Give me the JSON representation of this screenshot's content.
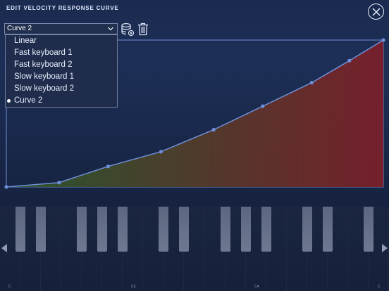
{
  "header": {
    "title": "EDIT VELOCITY RESPONSE CURVE"
  },
  "curve_selector": {
    "value": "Curve 2",
    "options": [
      {
        "label": "Linear",
        "selected": false
      },
      {
        "label": "Fast keyboard 1",
        "selected": false
      },
      {
        "label": "Fast keyboard 2",
        "selected": false
      },
      {
        "label": "Slow keyboard 1",
        "selected": false
      },
      {
        "label": "Slow keyboard 2",
        "selected": false
      },
      {
        "label": "Curve 2",
        "selected": true
      }
    ]
  },
  "icons": {
    "close": "close-icon",
    "save": "database-add-icon",
    "delete": "trash-icon",
    "chevron": "chevron-down-icon",
    "scroll_left": "arrow-left-icon",
    "scroll_right": "arrow-right-icon"
  },
  "curve": {
    "points": [
      [
        0,
        0
      ],
      [
        0.14,
        0.03
      ],
      [
        0.27,
        0.14
      ],
      [
        0.41,
        0.24
      ],
      [
        0.55,
        0.39
      ],
      [
        0.68,
        0.55
      ],
      [
        0.81,
        0.71
      ],
      [
        0.91,
        0.86
      ],
      [
        1.0,
        1.0
      ]
    ],
    "line_color": "#6f8fd9",
    "fill_start_color": "#2c5a2a",
    "fill_end_color": "#7a1f2a"
  },
  "keyboard": {
    "note_labels": [
      "C",
      "C3",
      "C4",
      "C"
    ]
  },
  "colors": {
    "background": "#1b2a4f",
    "accent": "#6f8fd9"
  }
}
